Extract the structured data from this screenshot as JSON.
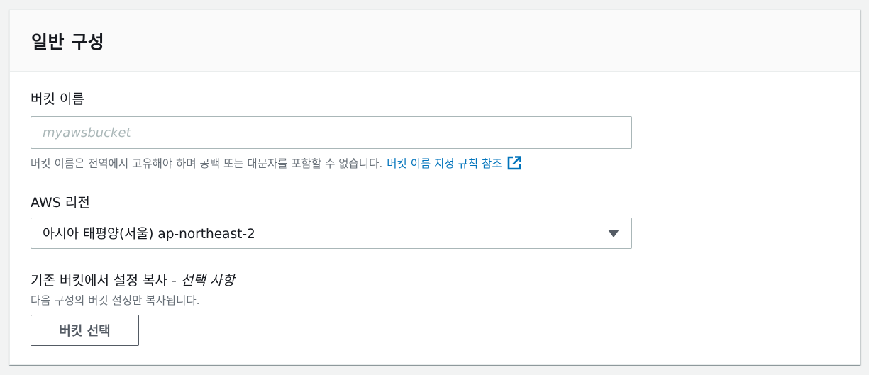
{
  "panel": {
    "title": "일반 구성"
  },
  "bucket_name": {
    "label": "버킷 이름",
    "value": "",
    "placeholder": "myawsbucket",
    "hint": "버킷 이름은 전역에서 고유해야 하며 공백 또는 대문자를 포함할 수 없습니다.",
    "link_label": "버킷 이름 지정 규칙 참조",
    "link_icon": "external-link-icon",
    "link_color": "#0073bb"
  },
  "region": {
    "label": "AWS 리전",
    "selected": "아시아 태평양(서울) ap-northeast-2",
    "caret_icon": "caret-down-icon"
  },
  "copy_settings": {
    "label": "기존 버킷에서 설정 복사 - ",
    "optional": "선택 사항",
    "description": "다음 구성의 버킷 설정만 복사됩니다.",
    "button_label": "버킷 선택"
  }
}
